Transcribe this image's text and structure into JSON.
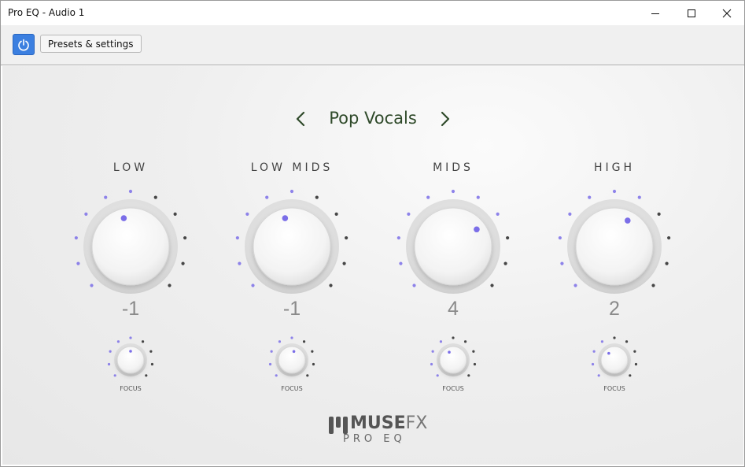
{
  "window": {
    "title": "Pro EQ - Audio 1"
  },
  "toolbar": {
    "presets_label": "Presets & settings"
  },
  "preset": {
    "name": "Pop Vocals"
  },
  "bands": [
    {
      "label": "LOW",
      "value": "-1",
      "focus_label": "FOCUS",
      "knob_fraction": 0.45,
      "focus_fraction": 0.5
    },
    {
      "label": "LOW MIDS",
      "value": "-1",
      "focus_label": "FOCUS",
      "knob_fraction": 0.45,
      "focus_fraction": 0.55
    },
    {
      "label": "MIDS",
      "value": "4",
      "focus_label": "FOCUS",
      "knob_fraction": 0.7,
      "focus_fraction": 0.4
    },
    {
      "label": "HIGH",
      "value": "2",
      "focus_label": "FOCUS",
      "knob_fraction": 0.6,
      "focus_fraction": 0.35
    }
  ],
  "logo": {
    "brand": "MUSE",
    "brand_suffix": "FX",
    "product": "PRO EQ"
  },
  "colors": {
    "accent": "#7b6ee8",
    "dot_inactive": "#333333",
    "power": "#3b7fe0",
    "preset_text": "#2f4a2a"
  }
}
